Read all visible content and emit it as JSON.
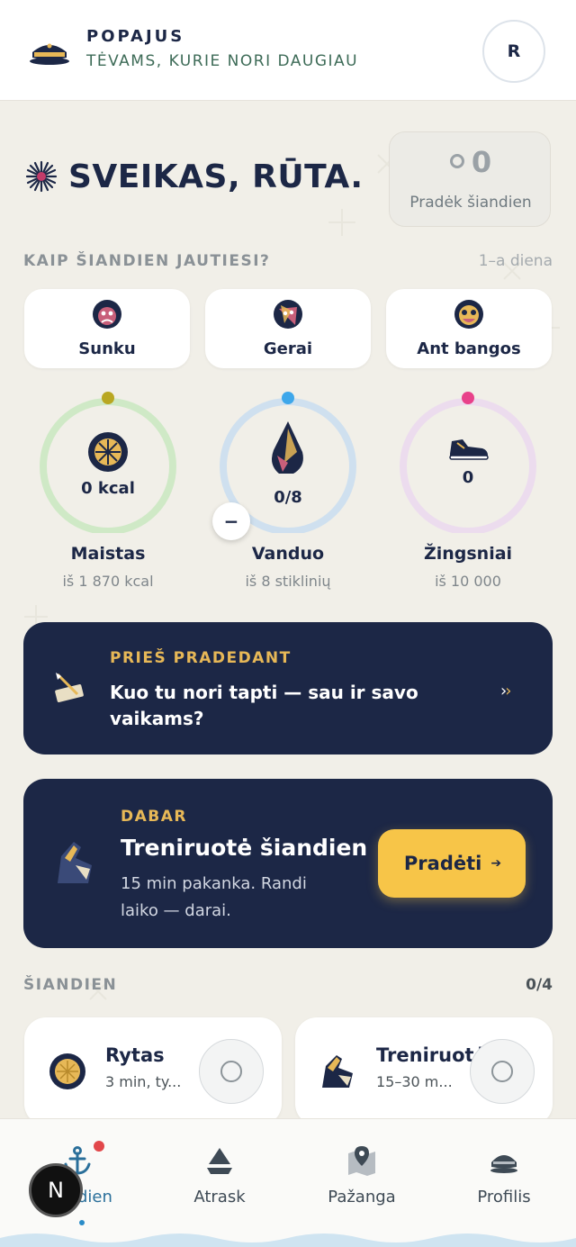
{
  "header": {
    "brand": "POPAJUS",
    "tagline": "TĖVAMS, KURIE NORI DAUGIAU",
    "avatar_initial": "R"
  },
  "greeting": "SVEIKAS, RŪTA.",
  "streak": {
    "count": "0",
    "label": "Pradėk šiandien"
  },
  "mood_section": {
    "title": "KAIP ŠIANDIEN JAUTIESI?",
    "day": "1–a diena",
    "options": [
      {
        "label": "Sunku",
        "icon": "sad-face-icon"
      },
      {
        "label": "Gerai",
        "icon": "neutral-face-icon"
      },
      {
        "label": "Ant bangos",
        "icon": "happy-face-icon"
      }
    ]
  },
  "metrics": [
    {
      "title": "Maistas",
      "value": "0 kcal",
      "sub": "iš 1 870 kcal",
      "color": "#cfe9c6",
      "dot": "#b9a722",
      "progress": 0
    },
    {
      "title": "Vanduo",
      "value": "0/8",
      "sub": "iš 8 stiklinių",
      "color": "#cfe0ef",
      "dot": "#3ea7ea",
      "progress": 0
    },
    {
      "title": "Žingsniai",
      "value": "0",
      "sub": "iš 10 000",
      "color": "#ecdcee",
      "dot": "#e8418a",
      "progress": 0
    }
  ],
  "prompt_card": {
    "eyebrow": "PRIEŠ PRADEDANT",
    "title": "Kuo tu nori tapti — sau ir savo vaikams?"
  },
  "workout_card": {
    "eyebrow": "DABAR",
    "title": "Treniruotė šiandien",
    "desc": "15 min pakanka. Randi laiko — darai.",
    "button": "Pradėti"
  },
  "today": {
    "title": "ŠIANDIEN",
    "count": "0/4",
    "tasks": [
      {
        "title": "Rytas",
        "sub": "3 min, ty..."
      },
      {
        "title": "Treniruotė",
        "sub": "15–30 m..."
      }
    ]
  },
  "nav": [
    {
      "label": "Šiandien",
      "icon": "anchor-icon"
    },
    {
      "label": "Atrask",
      "icon": "sailboat-icon"
    },
    {
      "label": "Pažanga",
      "icon": "map-pin-icon"
    },
    {
      "label": "Profilis",
      "icon": "captain-hat-icon"
    }
  ],
  "dev_badge": "N",
  "colors": {
    "navy": "#1c2746",
    "accent": "#f7c548",
    "eyebrow": "#e7b857",
    "tagline": "#3d6b57"
  }
}
